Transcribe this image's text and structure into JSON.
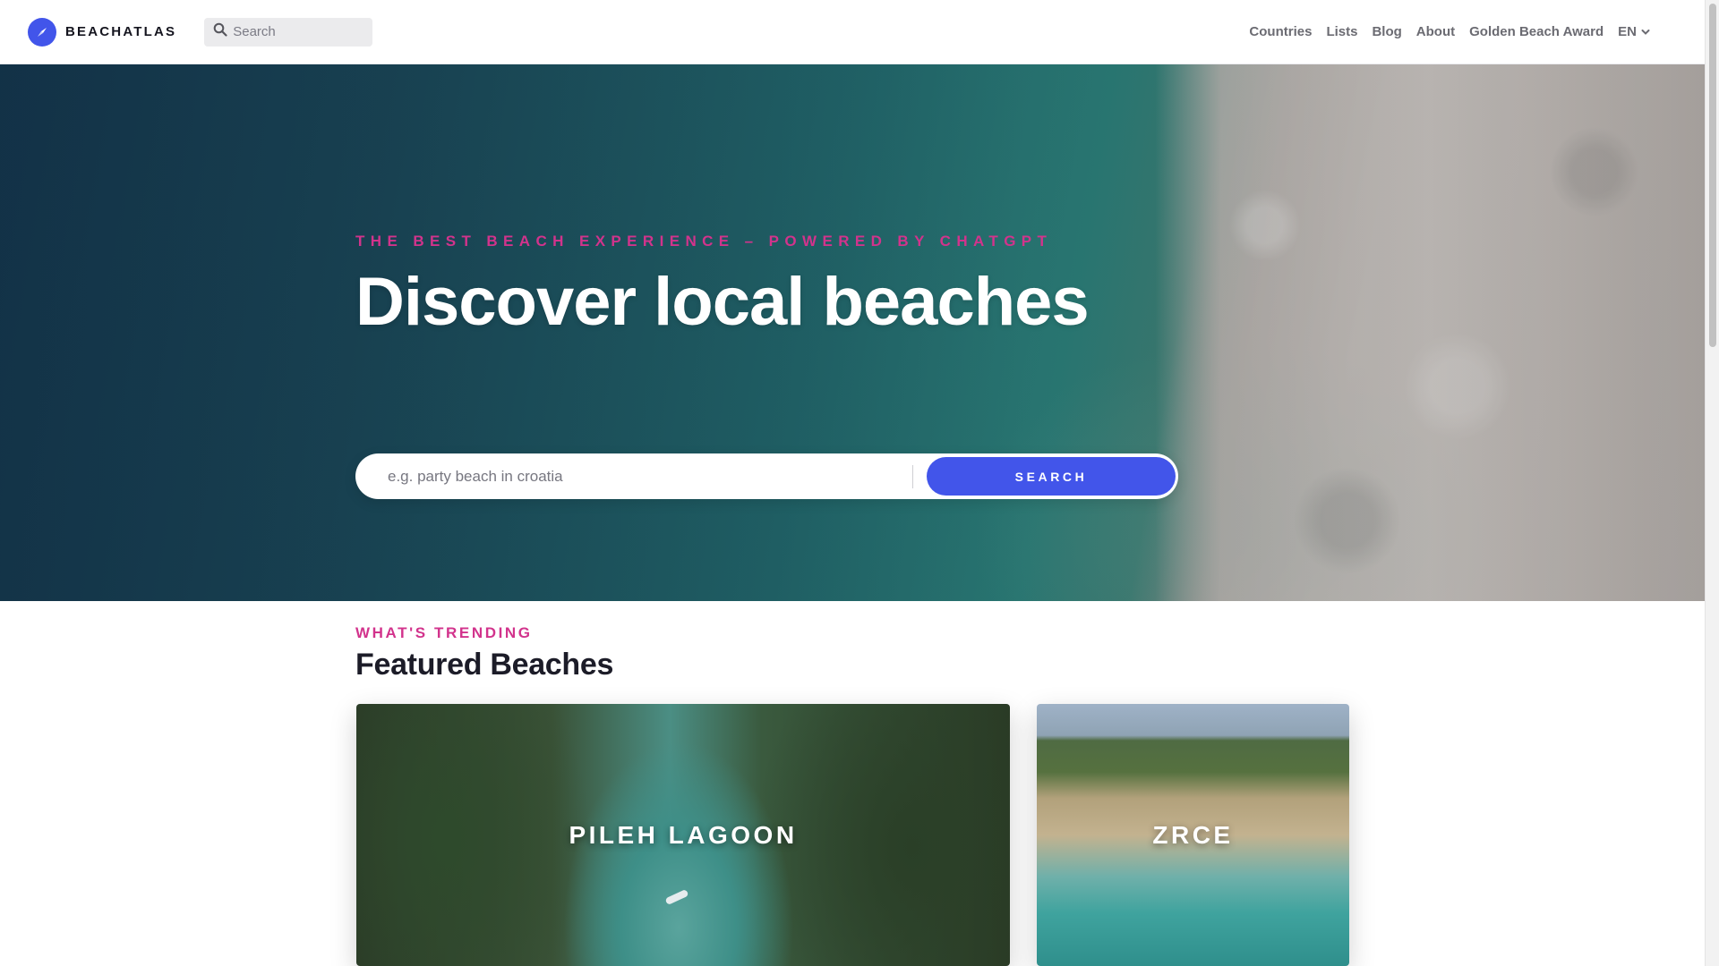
{
  "brand": {
    "name": "BEACHATLAS",
    "accent_color": "#4255ea",
    "highlight_color": "#d2338c"
  },
  "nav": {
    "search_placeholder": "Search",
    "links": [
      "Countries",
      "Lists",
      "Blog",
      "About",
      "Golden Beach Award"
    ],
    "language": "EN"
  },
  "hero": {
    "eyebrow": "THE BEST BEACH EXPERIENCE – POWERED BY CHATGPT",
    "title": "Discover local beaches",
    "search_placeholder": "e.g. party beach in croatia",
    "search_button": "SEARCH"
  },
  "featured": {
    "eyebrow": "WHAT'S TRENDING",
    "title": "Featured Beaches",
    "cards": [
      "PILEH LAGOON",
      "ZRCE"
    ]
  },
  "icons": {
    "logo": "compass-icon",
    "nav_search": "search-icon",
    "language": "chevron-down-icon"
  }
}
